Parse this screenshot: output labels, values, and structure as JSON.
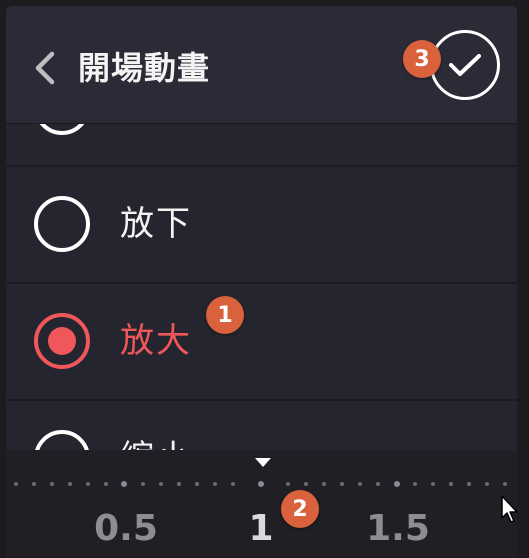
{
  "header": {
    "title": "開場動畫"
  },
  "options": [
    {
      "label": "",
      "selected": false
    },
    {
      "label": "放下",
      "selected": false
    },
    {
      "label": "放大",
      "selected": true
    },
    {
      "label": "縮小",
      "selected": false
    }
  ],
  "scrubber": {
    "value": 1,
    "labels": [
      "0.5",
      "1",
      "1.5"
    ]
  },
  "annotations": [
    "1",
    "2",
    "3"
  ],
  "colors": {
    "accent": "#f0575a",
    "badge": "#d9613c",
    "panel": "#25252f",
    "header": "#2b2b38"
  },
  "icons": {
    "back": "chevron-left-icon",
    "confirm": "check-icon",
    "pointer": "caret-down-icon"
  }
}
